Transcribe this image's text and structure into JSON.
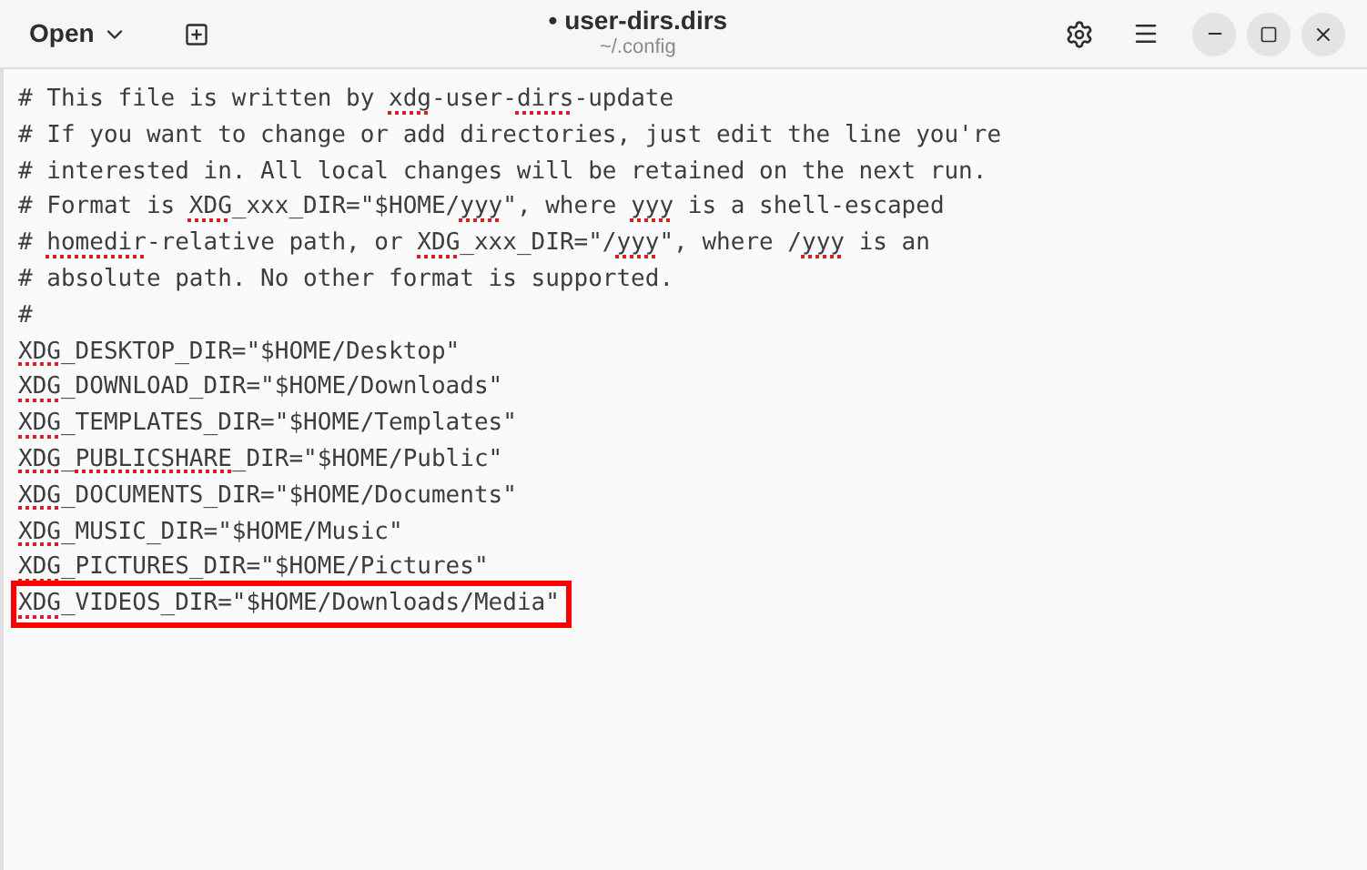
{
  "header": {
    "open_label": "Open",
    "title": "user-dirs.dirs",
    "modified_mark": "•",
    "subtitle": "~/.config"
  },
  "lines": [
    {
      "highlighted": false,
      "segments": [
        {
          "text": "# This file is written by ",
          "misspelled": false
        },
        {
          "text": "xdg",
          "misspelled": true
        },
        {
          "text": "-user-",
          "misspelled": false
        },
        {
          "text": "dirs",
          "misspelled": true
        },
        {
          "text": "-update",
          "misspelled": false
        }
      ]
    },
    {
      "highlighted": false,
      "segments": [
        {
          "text": "# If you want to change or add directories, just edit the line you're",
          "misspelled": false
        }
      ]
    },
    {
      "highlighted": false,
      "segments": [
        {
          "text": "# interested in. All local changes will be retained on the next run.",
          "misspelled": false
        }
      ]
    },
    {
      "highlighted": false,
      "segments": [
        {
          "text": "# Format is ",
          "misspelled": false
        },
        {
          "text": "XDG",
          "misspelled": true
        },
        {
          "text": "_xxx_DIR=\"$HOME/",
          "misspelled": false
        },
        {
          "text": "yyy",
          "misspelled": true
        },
        {
          "text": "\", where ",
          "misspelled": false
        },
        {
          "text": "yyy",
          "misspelled": true
        },
        {
          "text": " is a shell-escaped",
          "misspelled": false
        }
      ]
    },
    {
      "highlighted": false,
      "segments": [
        {
          "text": "# ",
          "misspelled": false
        },
        {
          "text": "homedir",
          "misspelled": true
        },
        {
          "text": "-relative path, or ",
          "misspelled": false
        },
        {
          "text": "XDG",
          "misspelled": true
        },
        {
          "text": "_xxx_DIR=\"/",
          "misspelled": false
        },
        {
          "text": "yyy",
          "misspelled": true
        },
        {
          "text": "\", where /",
          "misspelled": false
        },
        {
          "text": "yyy",
          "misspelled": true
        },
        {
          "text": " is an",
          "misspelled": false
        }
      ]
    },
    {
      "highlighted": false,
      "segments": [
        {
          "text": "# absolute path. No other format is supported.",
          "misspelled": false
        }
      ]
    },
    {
      "highlighted": false,
      "segments": [
        {
          "text": "#",
          "misspelled": false
        }
      ]
    },
    {
      "highlighted": false,
      "segments": [
        {
          "text": "XDG",
          "misspelled": true
        },
        {
          "text": "_DESKTOP_DIR=\"$HOME/Desktop\"",
          "misspelled": false
        }
      ]
    },
    {
      "highlighted": false,
      "segments": [
        {
          "text": "XDG",
          "misspelled": true
        },
        {
          "text": "_DOWNLOAD_DIR=\"$HOME/Downloads\"",
          "misspelled": false
        }
      ]
    },
    {
      "highlighted": false,
      "segments": [
        {
          "text": "XDG",
          "misspelled": true
        },
        {
          "text": "_TEMPLATES_DIR=\"$HOME/Templates\"",
          "misspelled": false
        }
      ]
    },
    {
      "highlighted": false,
      "segments": [
        {
          "text": "XDG",
          "misspelled": true
        },
        {
          "text": "_",
          "misspelled": false
        },
        {
          "text": "PUBLICSHARE",
          "misspelled": true
        },
        {
          "text": "_DIR=\"$HOME/Public\"",
          "misspelled": false
        }
      ]
    },
    {
      "highlighted": false,
      "segments": [
        {
          "text": "XDG",
          "misspelled": true
        },
        {
          "text": "_DOCUMENTS_DIR=\"$HOME/Documents\"",
          "misspelled": false
        }
      ]
    },
    {
      "highlighted": false,
      "segments": [
        {
          "text": "XDG",
          "misspelled": true
        },
        {
          "text": "_MUSIC_DIR=\"$HOME/Music\"",
          "misspelled": false
        }
      ]
    },
    {
      "highlighted": false,
      "segments": [
        {
          "text": "XDG",
          "misspelled": true
        },
        {
          "text": "_PICTURES_DIR=\"$HOME/Pictures\"",
          "misspelled": false
        }
      ]
    },
    {
      "highlighted": true,
      "segments": [
        {
          "text": "XDG",
          "misspelled": true
        },
        {
          "text": "_VIDEOS_DIR=\"$HOME/Downloads/Media\"",
          "misspelled": false
        }
      ]
    }
  ]
}
